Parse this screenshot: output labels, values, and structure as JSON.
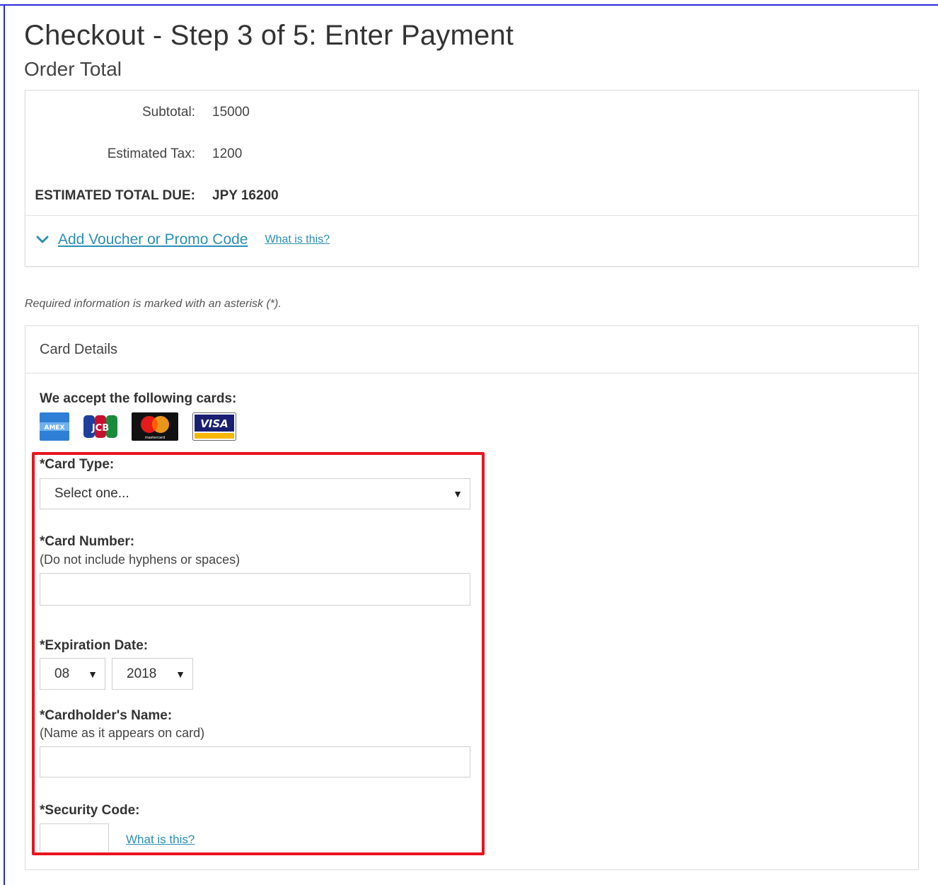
{
  "page": {
    "title": "Checkout - Step 3 of 5: Enter Payment",
    "subtitle": "Order Total"
  },
  "order": {
    "subtotal_label": "Subtotal:",
    "subtotal_value": "15000",
    "tax_label": "Estimated Tax:",
    "tax_value": "1200",
    "total_label": "ESTIMATED TOTAL DUE:",
    "total_value": "JPY 16200",
    "promo_link": "Add Voucher or Promo Code",
    "promo_help": "What is this?"
  },
  "required_note": "Required information is marked with an asterisk (*).",
  "card_details": {
    "header": "Card Details",
    "accept_label": "We accept the following cards:",
    "card_logos": [
      "AMEX",
      "JCB",
      "mastercard",
      "VISA"
    ],
    "card_type_label": "*Card Type:",
    "card_type_value": "Select one...",
    "card_number_label": "*Card Number:",
    "card_number_hint": "(Do not include hyphens or spaces)",
    "card_number_value": "",
    "expiration_label": "*Expiration Date:",
    "exp_month": "08",
    "exp_year": "2018",
    "cardholder_label": "*Cardholder's Name:",
    "cardholder_hint": "(Name as it appears on card)",
    "cardholder_value": "",
    "security_label": "*Security Code:",
    "security_value": "",
    "security_help": "What is this?"
  },
  "icons": {
    "promo_toggle": "chevron-down-icon",
    "dropdown": "triangle-down-icon"
  },
  "colors": {
    "link": "#2a8fb8",
    "highlight": "#e8141e",
    "frame": "#2a2ad8"
  }
}
